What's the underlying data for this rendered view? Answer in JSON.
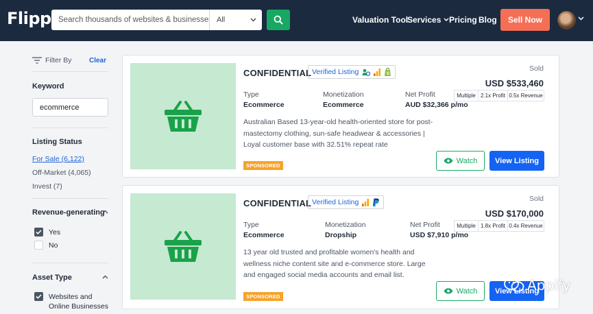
{
  "header": {
    "logo": "Flippa",
    "search_placeholder": "Search thousands of websites & businesses",
    "search_category": "All",
    "nav": [
      "Valuation Tool",
      "Services",
      "Pricing",
      "Blog"
    ],
    "sell_label": "Sell Now"
  },
  "sidebar": {
    "filter_by": "Filter By",
    "clear": "Clear",
    "keyword_heading": "Keyword",
    "keyword_value": "ecommerce",
    "listing_status_heading": "Listing Status",
    "listing_status": [
      "For Sale (6,122)",
      "Off-Market (4,065)",
      "Invest (7)"
    ],
    "revenue_heading": "Revenue-generating",
    "revenue_options": [
      {
        "label": "Yes",
        "checked": true
      },
      {
        "label": "No",
        "checked": false
      }
    ],
    "asset_type_heading": "Asset Type",
    "asset_type_options": [
      {
        "label": "Websites and Online Businesses",
        "checked": true
      }
    ]
  },
  "listings": [
    {
      "title": "CONFIDENTIAL",
      "verified": "Verified Listing",
      "status": "Sold",
      "price": "USD $533,460",
      "type_label": "Type",
      "type_value": "Ecommerce",
      "monetization_label": "Monetization",
      "monetization_value": "Ecommerce",
      "profit_label": "Net Profit",
      "profit_value": "AUD $32,366 p/mo",
      "multiples": [
        "Multiple",
        "2.1x Profit",
        "0.5x Revenue"
      ],
      "description": "Australian Based 13-year-old health-oriented store for post-mastectomy clothing, sun-safe headwear & accessories | Loyal customer base with 32.51% repeat rate",
      "sponsored": "SPONSORED",
      "watch": "Watch",
      "view": "View Listing"
    },
    {
      "title": "CONFIDENTIAL",
      "verified": "Verified Listing",
      "status": "Sold",
      "price": "USD $170,000",
      "type_label": "Type",
      "type_value": "Ecommerce",
      "monetization_label": "Monetization",
      "monetization_value": "Dropship",
      "profit_label": "Net Profit",
      "profit_value": "USD $7,910 p/mo",
      "multiples": [
        "Multiple",
        "1.8x Profit",
        "0.4x Revenue"
      ],
      "description": "13 year old trusted and profitable women's health and wellness niche content site and e-commerce store. Large and engaged social media accounts and email list.",
      "sponsored": "SPONSORED",
      "watch": "Watch",
      "view": "View Listing"
    }
  ],
  "watermark": "Appify",
  "colors": {
    "header_bg": "#1b2a3f",
    "brand_green": "#17a863",
    "sell_coral": "#f46f55",
    "primary_blue": "#1463f3",
    "link_blue": "#1e63d6",
    "sponsored_orange": "#f6a32b",
    "thumb_green": "#c6e9d1"
  }
}
